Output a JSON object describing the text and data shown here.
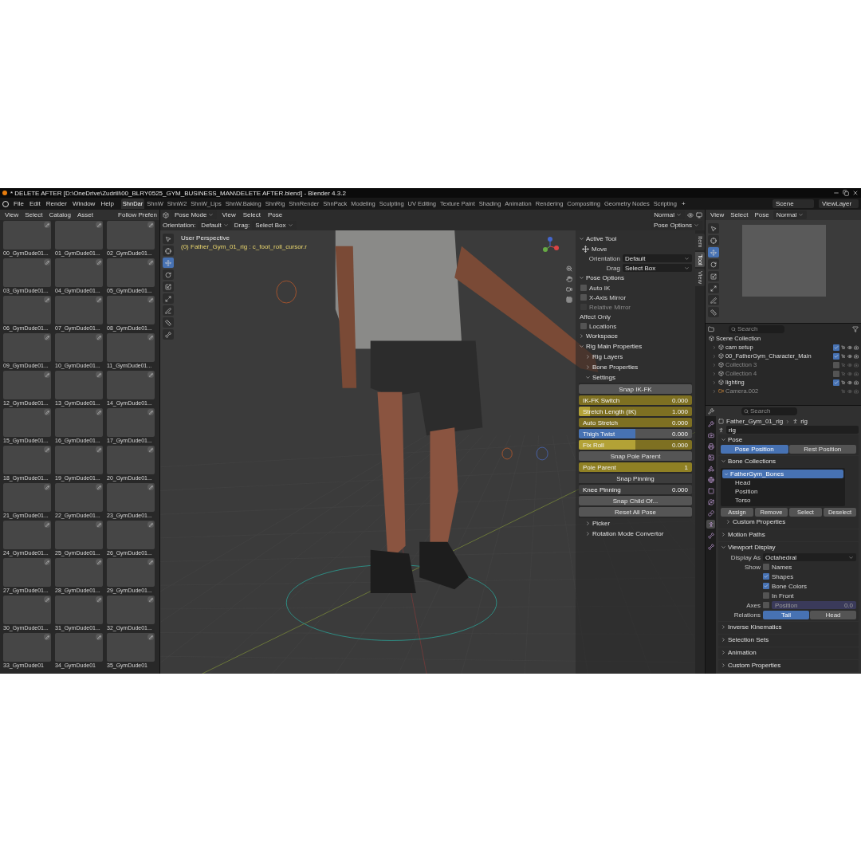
{
  "window": {
    "title": "* DELETE AFTER [D:\\OneDrive\\Zudrill\\00_BLRY0525_GYM_BUSINESS_MAN\\DELETE AFTER.blend] - Blender 4.3.2"
  },
  "menu": [
    "File",
    "Edit",
    "Render",
    "Window",
    "Help"
  ],
  "workspaces": [
    {
      "label": "ShnDar",
      "selected": true
    },
    {
      "label": "ShnW",
      "selected": false
    },
    {
      "label": "ShnW2",
      "selected": false
    },
    {
      "label": "ShnW_Lips",
      "selected": false
    },
    {
      "label": "ShnW.Baking",
      "selected": false
    },
    {
      "label": "ShnRig",
      "selected": false
    },
    {
      "label": "ShnRender",
      "selected": false
    },
    {
      "label": "ShnPack",
      "selected": false
    },
    {
      "label": "Modeling",
      "selected": false
    },
    {
      "label": "Sculpting",
      "selected": false
    },
    {
      "label": "UV Editing",
      "selected": false
    },
    {
      "label": "Texture Paint",
      "selected": false
    },
    {
      "label": "Shading",
      "selected": false
    },
    {
      "label": "Animation",
      "selected": false
    },
    {
      "label": "Rendering",
      "selected": false
    },
    {
      "label": "Compositing",
      "selected": false
    },
    {
      "label": "Geometry Nodes",
      "selected": false
    },
    {
      "label": "Scripting",
      "selected": false
    }
  ],
  "add_workspace": "+",
  "scene": "Scene",
  "view_layer": "ViewLayer",
  "asset_browser": {
    "menu": [
      "View",
      "Select",
      "Catalog",
      "Asset"
    ],
    "follow": "Follow Prefen",
    "assets": [
      "00_GymDude01...",
      "01_GymDude01...",
      "02_GymDude01...",
      "03_GymDude01...",
      "04_GymDude01...",
      "05_GymDude01...",
      "06_GymDude01...",
      "07_GymDude01...",
      "08_GymDude01...",
      "09_GymDude01...",
      "10_GymDude01...",
      "11_GymDude01...",
      "12_GymDude01...",
      "13_GymDude01...",
      "14_GymDude01...",
      "15_GymDude01...",
      "16_GymDude01...",
      "17_GymDude01...",
      "18_GymDude01...",
      "19_GymDude01...",
      "20_GymDude01...",
      "21_GymDude01...",
      "22_GymDude01...",
      "23_GymDude01...",
      "24_GymDude01...",
      "25_GymDude01...",
      "26_GymDude01...",
      "27_GymDude01...",
      "28_GymDude01...",
      "29_GymDude01...",
      "30_GymDude01...",
      "31_GymDude01...",
      "32_GymDude01...",
      "33_GymDude01",
      "34_GymDude01",
      "35_GymDude01"
    ]
  },
  "viewport": {
    "mode": "Pose Mode",
    "menu": [
      "View",
      "Select",
      "Pose"
    ],
    "orientation_label": "Orientation:",
    "orientation": "Default",
    "drag_label": "Drag:",
    "drag": "Select Box",
    "transform": "Normal",
    "pose_options": "Pose Options",
    "perspective": "User Perspective",
    "active": "(0) Father_Gym_01_rig : c_foot_roll_cursor.r",
    "tools": [
      {
        "kind": "select",
        "selected": false
      },
      {
        "kind": "cursor",
        "selected": false
      },
      {
        "kind": "move",
        "selected": true
      },
      {
        "kind": "rotate",
        "selected": false
      },
      {
        "kind": "scale",
        "selected": false
      },
      {
        "kind": "transform",
        "selected": false
      },
      {
        "kind": "annotate",
        "selected": false
      },
      {
        "kind": "measure",
        "selected": false
      },
      {
        "kind": "roll",
        "selected": false
      }
    ]
  },
  "sidebar": {
    "tabs": [
      {
        "label": "Item",
        "selected": false
      },
      {
        "label": "Tool",
        "selected": true
      },
      {
        "label": "View",
        "selected": false
      }
    ],
    "panels": [
      {
        "title": "Active Tool",
        "expanded": true,
        "rows": [
          {
            "kind": "tool",
            "label": "Move"
          },
          {
            "kind": "dropdown",
            "label": "Orientation",
            "value": "Default"
          },
          {
            "kind": "dropdown",
            "label": "Drag",
            "value": "Select Box"
          }
        ]
      },
      {
        "title": "Pose Options",
        "expanded": true,
        "rows": [
          {
            "kind": "checkbox",
            "label": "Auto IK",
            "checked": false,
            "disabled": false
          },
          {
            "kind": "checkbox",
            "label": "X-Axis Mirror",
            "checked": false,
            "disabled": false
          },
          {
            "kind": "checkbox",
            "label": "Relative Mirror",
            "checked": false,
            "disabled": true
          },
          {
            "kind": "label",
            "label": "Affect Only"
          },
          {
            "kind": "checkbox",
            "label": "Locations",
            "checked": false,
            "disabled": false
          }
        ]
      },
      {
        "title": "Workspace",
        "expanded": false
      },
      {
        "title": "Rig Main Properties",
        "expanded": true,
        "subpanels": [
          {
            "title": "Rig Layers",
            "expanded": false
          },
          {
            "title": "Bone Properties",
            "expanded": false
          },
          {
            "title": "Settings",
            "expanded": true,
            "rows": [
              {
                "kind": "button",
                "label": "Snap IK-FK"
              },
              {
                "kind": "slider",
                "label": "IK-FK Switch",
                "value": "0.000",
                "level": 0,
                "keyed": true
              },
              {
                "kind": "slider",
                "label": "Stretch Length (IK)",
                "value": "1.000",
                "level": 0.1,
                "keyed": true
              },
              {
                "kind": "slider",
                "label": "Auto Stretch",
                "value": "0.000",
                "level": 0,
                "keyed": true
              },
              {
                "kind": "slider",
                "label": "Thigh Twist",
                "value": "0.000",
                "level": 0.5,
                "keyed": false
              },
              {
                "kind": "slider",
                "label": "Fix Roll",
                "value": "0.000",
                "level": 0.5,
                "keyed": true
              },
              {
                "kind": "button",
                "label": "Snap Pole Parent"
              },
              {
                "kind": "number",
                "label": "Pole Parent",
                "value": "1",
                "keyed": true
              },
              {
                "kind": "heading",
                "label": "Snap Pinning"
              },
              {
                "kind": "number",
                "label": "Knee Pinning",
                "value": "0.000",
                "keyed": false
              },
              {
                "kind": "button",
                "label": "Snap Child Of..."
              },
              {
                "kind": "button",
                "label": "Reset All Pose"
              }
            ]
          },
          {
            "title": "Picker",
            "expanded": false
          },
          {
            "title": "Rotation Mode Convertor",
            "expanded": false
          }
        ]
      }
    ]
  },
  "preview": {
    "menu": [
      "View",
      "Select",
      "Pose"
    ],
    "transform": "Normal",
    "tools": [
      {
        "kind": "select",
        "selected": false
      },
      {
        "kind": "cursor",
        "selected": false
      },
      {
        "kind": "move",
        "selected": true
      },
      {
        "kind": "rotate",
        "selected": false
      },
      {
        "kind": "scale",
        "selected": false
      },
      {
        "kind": "transform",
        "selected": false
      },
      {
        "kind": "annotate",
        "selected": false
      },
      {
        "kind": "measure",
        "selected": false
      }
    ]
  },
  "outliner": {
    "search_placeholder": "Search",
    "root": "Scene Collection",
    "items": [
      {
        "name": "cam setup",
        "kind": "collection",
        "checked": true,
        "disabled": false
      },
      {
        "name": "00_FatherGym_Character_Main",
        "kind": "collection",
        "checked": true,
        "disabled": false
      },
      {
        "name": "Collection 3",
        "kind": "collection",
        "checked": false,
        "disabled": true
      },
      {
        "name": "Collection 4",
        "kind": "collection",
        "checked": false,
        "disabled": true
      },
      {
        "name": "lighting",
        "kind": "collection",
        "checked": true,
        "disabled": false
      },
      {
        "name": "Camera.002",
        "kind": "camera",
        "disabled": true
      }
    ]
  },
  "properties": {
    "search_placeholder": "Search",
    "object": "Father_Gym_01_rig",
    "data": "rig",
    "name": "rig",
    "tabs": [
      {
        "kind": "tool",
        "selected": false
      },
      {
        "kind": "render",
        "selected": false
      },
      {
        "kind": "output",
        "selected": false
      },
      {
        "kind": "view_layer",
        "selected": false
      },
      {
        "kind": "scene",
        "selected": false
      },
      {
        "kind": "world",
        "selected": false
      },
      {
        "kind": "object",
        "selected": false
      },
      {
        "kind": "physics",
        "selected": false
      },
      {
        "kind": "constraints",
        "selected": false
      },
      {
        "kind": "data",
        "selected": true
      },
      {
        "kind": "bone",
        "selected": false
      },
      {
        "kind": "roll",
        "selected": false
      }
    ],
    "panels": [
      {
        "kind": "toggle",
        "title": "Pose",
        "expanded": true,
        "options": [
          {
            "label": "Pose Position",
            "selected": true
          },
          {
            "label": "Rest Position",
            "selected": false
          }
        ]
      },
      {
        "kind": "collections",
        "title": "Bone Collections",
        "expanded": true,
        "tree": [
          {
            "name": "FatherGym_Bones",
            "selected": true,
            "expanded": true,
            "children": [
              {
                "name": "Head",
                "selected": false
              },
              {
                "name": "Position",
                "selected": false
              },
              {
                "name": "Torso",
                "selected": false
              }
            ]
          }
        ],
        "buttons": [
          "Assign",
          "Remove",
          "Select",
          "Deselect"
        ],
        "subpanel": {
          "title": "Custom Properties",
          "expanded": false
        }
      },
      {
        "title": "Motion Paths",
        "expanded": false
      },
      {
        "kind": "display",
        "title": "Viewport Display",
        "expanded": true,
        "display_as_label": "Display As",
        "display_as": "Octahedral",
        "show_label": "Show",
        "show": [
          {
            "label": "Names",
            "checked": false
          },
          {
            "label": "Shapes",
            "checked": true
          },
          {
            "label": "Bone Colors",
            "checked": true
          },
          {
            "label": "In Front",
            "checked": false
          }
        ],
        "axes_label": "Axes",
        "axes_checked": false,
        "axes_field": "Position",
        "axes_value": "0.0",
        "relations_label": "Relations",
        "relations": [
          {
            "label": "Tail",
            "selected": true
          },
          {
            "label": "Head",
            "selected": false
          }
        ]
      },
      {
        "title": "Inverse Kinematics",
        "expanded": false
      },
      {
        "title": "Selection Sets",
        "expanded": false
      },
      {
        "title": "Animation",
        "expanded": false
      },
      {
        "title": "Custom Properties",
        "expanded": false
      }
    ]
  }
}
